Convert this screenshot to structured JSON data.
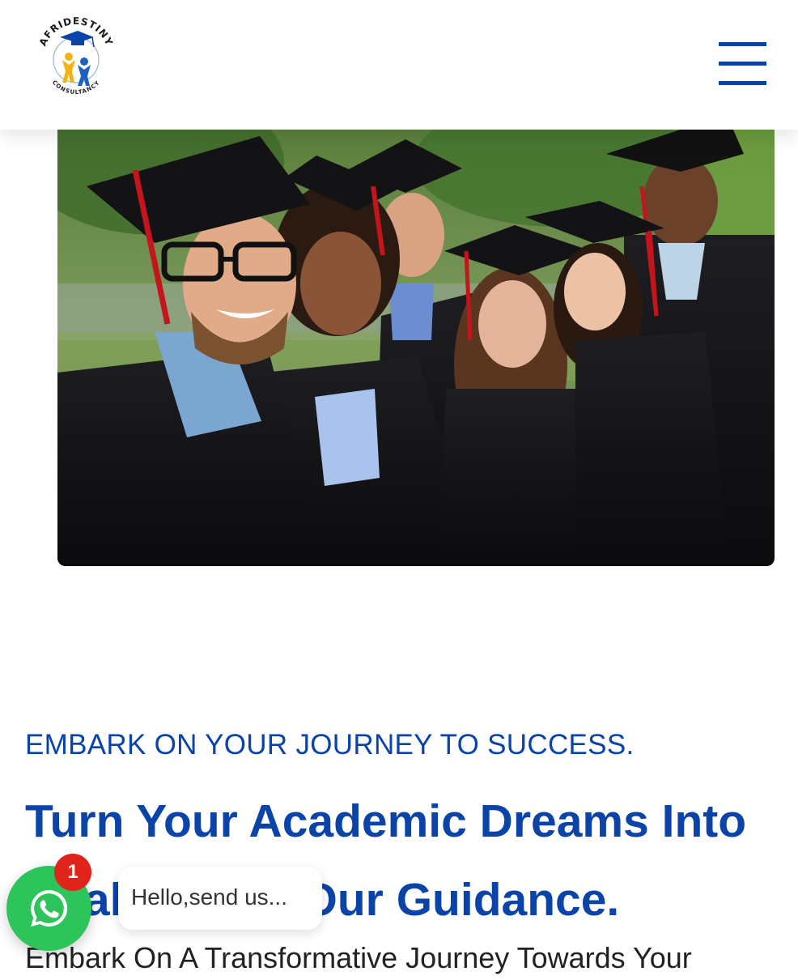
{
  "header": {
    "logo_text_top": "AFRIDESTINY",
    "logo_text_bottom": "CONSULTANCY"
  },
  "hero": {
    "eyebrow": "EMBARK ON YOUR JOURNEY TO SUCCESS.",
    "heading": "Turn Your Academic Dreams Into Reality With Our Guidance.",
    "subtext": "Embark On A Transformative Journey Towards Your"
  },
  "whatsapp": {
    "badge_count": "1",
    "bubble_text": "Hello,send us..."
  },
  "colors": {
    "brand_blue": "#0a44a8",
    "whatsapp_green": "#2dc45b",
    "badge_red": "#e0241b"
  }
}
